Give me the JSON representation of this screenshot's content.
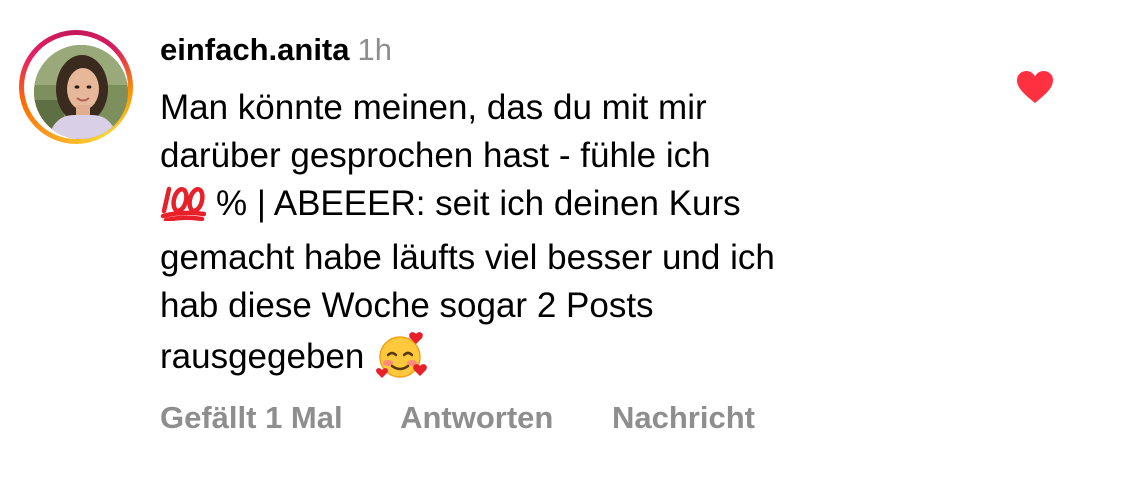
{
  "comment": {
    "username": "einfach.anita",
    "timestamp": "1h",
    "lines": {
      "l1": "Man könnte meinen, das du mit mir",
      "l2": "darüber gesprochen hast - fühle ich",
      "l3": "% | ABEEER: seit ich deinen Kurs",
      "l4": "gemacht habe läufts viel besser und ich",
      "l5": "hab diese Woche sogar 2 Posts",
      "l6": "rausgegeben"
    },
    "emojis": [
      "hundred-points-emoji",
      "smiling-face-with-hearts-emoji"
    ],
    "liked": true,
    "like_color": "#ff3040"
  },
  "actions": {
    "likes": "Gefällt 1 Mal",
    "reply": "Antworten",
    "message": "Nachricht"
  },
  "colors": {
    "secondary_text": "#8e8e8e",
    "primary_text": "#000000"
  }
}
